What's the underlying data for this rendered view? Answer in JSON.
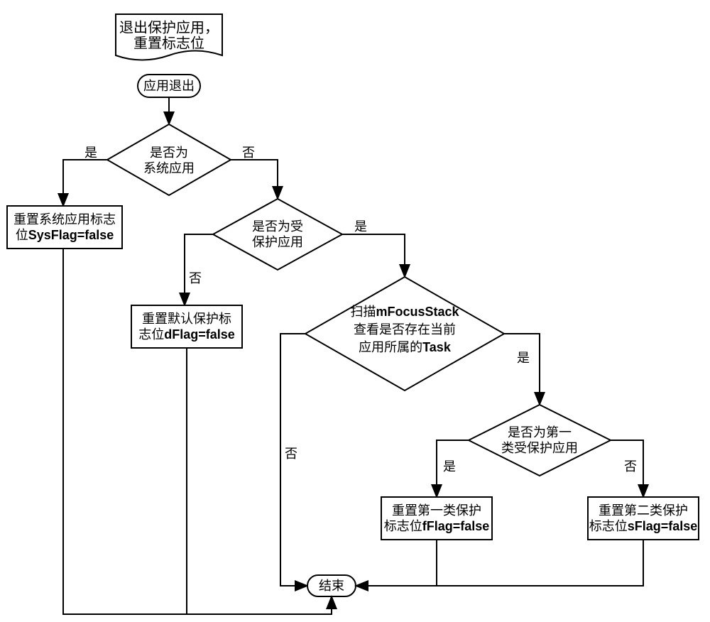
{
  "title": {
    "line1": "退出保护应用，",
    "line2": "重置标志位"
  },
  "start": "应用退出",
  "dec1": {
    "l1": "是否为",
    "l2": "系统应用"
  },
  "dec2": {
    "l1": "是否为受",
    "l2": "保护应用"
  },
  "dec3": {
    "l1": "扫描",
    "l1b": "mFocusStack",
    "l2": "查看是否存在当前",
    "l3": "应用所属的",
    "l3b": "Task"
  },
  "dec4": {
    "l1": "是否为第一",
    "l2": "类受保护应用"
  },
  "proc1": {
    "l1": "重置系统应用标志",
    "l2a": "位",
    "l2b": "SysFlag=false"
  },
  "proc2": {
    "l1": "重置默认保护标",
    "l2a": "志位",
    "l2b": "dFlag=false"
  },
  "proc3": {
    "l1": "重置第一类保护",
    "l2a": "标志位",
    "l2b": "fFlag=false"
  },
  "proc4": {
    "l1": "重置第二类保护",
    "l2a": "标志位",
    "l2b": "sFlag=false"
  },
  "end": "结束",
  "yes": "是",
  "no": "否"
}
